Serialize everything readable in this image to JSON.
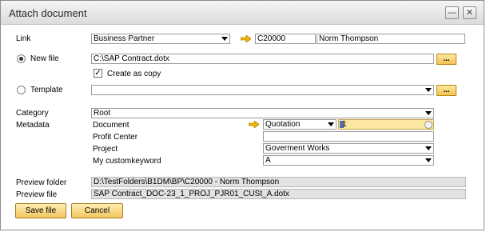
{
  "window": {
    "title": "Attach document"
  },
  "link": {
    "label": "Link",
    "type_value": "Business Partner",
    "code_value": "C20000",
    "name_value": "Norm Thompson"
  },
  "new_file": {
    "label": "New file",
    "path_value": "C:\\SAP Contract.dotx",
    "browse_label": "...",
    "create_as_copy_label": "Create as copy",
    "create_as_copy_checked": true,
    "selected": true
  },
  "template": {
    "label": "Template",
    "value": "",
    "browse_label": "..."
  },
  "category": {
    "label": "Category",
    "value": "Root"
  },
  "metadata": {
    "label": "Metadata",
    "fields": {
      "document": {
        "label": "Document",
        "type_value": "Quotation",
        "number_value": "1"
      },
      "profit_center": {
        "label": "Profit Center",
        "value": ""
      },
      "project": {
        "label": "Project",
        "value": "Goverment Works"
      },
      "custom_keyword": {
        "label": "My customkeyword",
        "value": "A"
      }
    }
  },
  "preview": {
    "folder_label": "Preview folder",
    "folder_value": "D:\\TestFolders\\B1DM\\BP\\C20000 - Norm Thompson",
    "file_label": "Preview file",
    "file_value": "SAP Contract_DOC-23_1_PROJ_PJR01_CUSt_A.dotx"
  },
  "actions": {
    "save_label": "Save file",
    "cancel_label": "Cancel"
  },
  "icons": {
    "link_arrow": "orange-right-arrow-icon",
    "minimize": "minimize-icon",
    "close": "close-icon"
  },
  "colors": {
    "accent_button": "#f2c660",
    "arrow": "#f2b600",
    "highlight_field": "#fbe7a1"
  }
}
